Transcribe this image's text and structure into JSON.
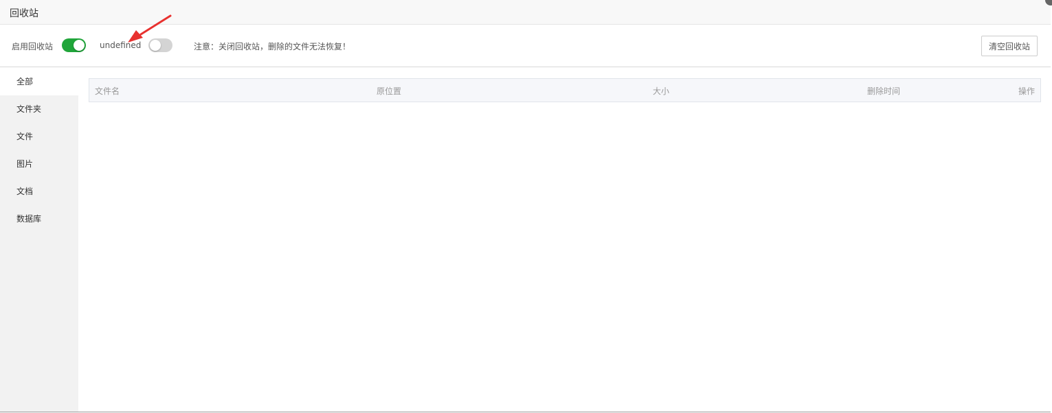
{
  "window": {
    "title": "回收站"
  },
  "toolbar": {
    "recycle_label": "启用回收站",
    "recycle_enabled": true,
    "db_label": "undefined",
    "db_enabled": false,
    "notice": "注意：关闭回收站，删除的文件无法恢复！",
    "clear_label": "清空回收站"
  },
  "sidebar": {
    "items": [
      {
        "label": "全部",
        "active": true
      },
      {
        "label": "文件夹"
      },
      {
        "label": "文件"
      },
      {
        "label": "图片"
      },
      {
        "label": "文档"
      },
      {
        "label": "数据库"
      }
    ]
  },
  "table": {
    "columns": [
      "文件名",
      "原位置",
      "大小",
      "删除时间",
      "操作"
    ]
  },
  "colors": {
    "toggle_on": "#20a53a",
    "toggle_off": "#d4d4d4",
    "arrow": "#e8312f"
  }
}
